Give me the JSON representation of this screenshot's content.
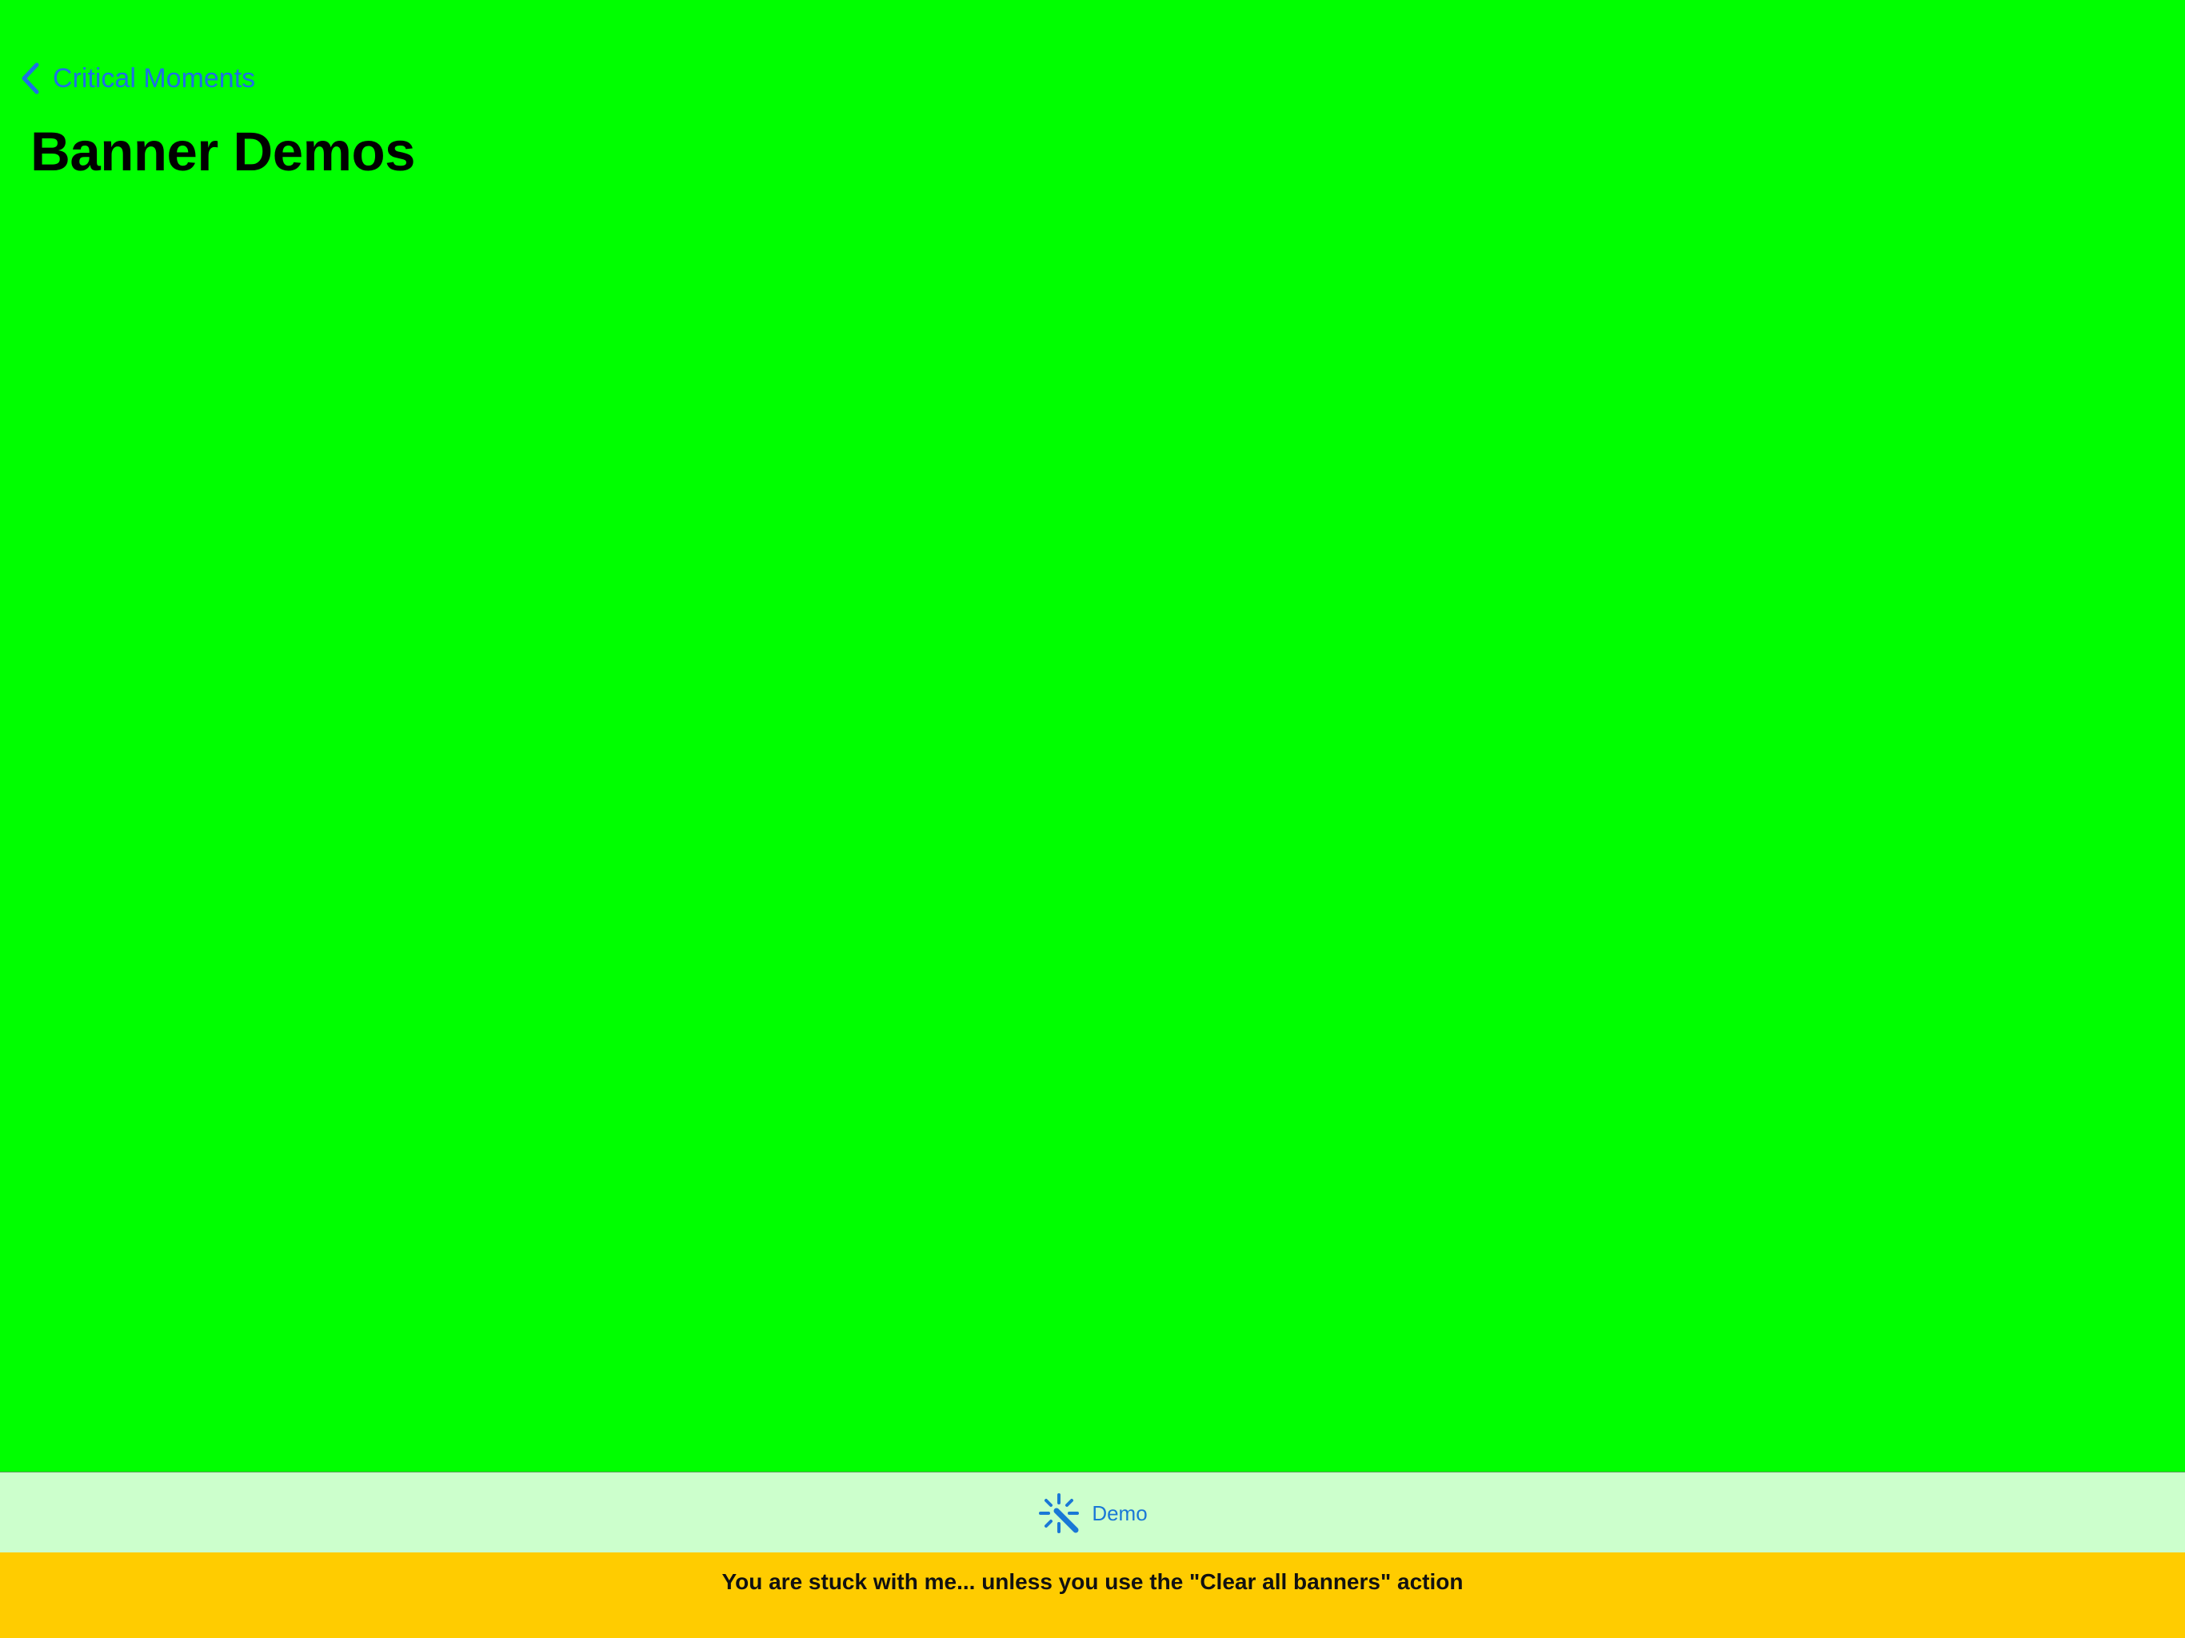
{
  "nav": {
    "back_label": "Critical Moments",
    "back_icon": "chevron-left-icon",
    "title": "Banner Demos"
  },
  "tab_bar": {
    "items": [
      {
        "label": "Demo",
        "icon": "wand-sparkles-icon"
      }
    ]
  },
  "banner": {
    "text": "You are stuck with me... unless you use the \"Clear all banners\" action"
  },
  "colors": {
    "background": "#00FF00",
    "tab_bar": "#CCFFCC",
    "banner": "#FFCC00",
    "accent": "#1E6FE6"
  }
}
